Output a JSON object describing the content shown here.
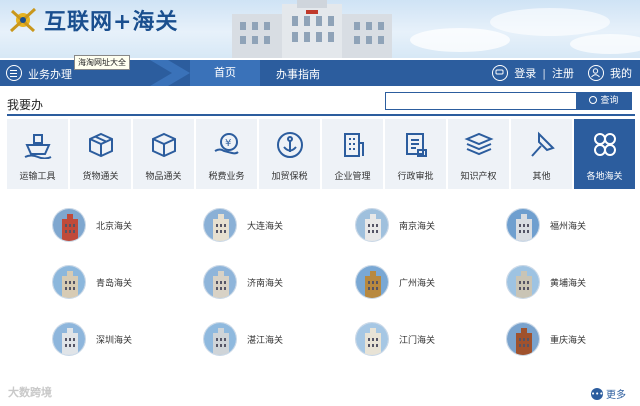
{
  "header": {
    "site_title": "互联网+海关",
    "tooltip": "海淘网址大全"
  },
  "navbar": {
    "business_label": "业务办理",
    "home_label": "首页",
    "guide_label": "办事指南",
    "login_label": "登录",
    "separator": "|",
    "register_label": "注册",
    "mine_label": "我的"
  },
  "section": {
    "title": "我要办",
    "search_placeholder": "",
    "search_button": "查询"
  },
  "categories": [
    {
      "label": "运输工具",
      "icon": "ship-icon"
    },
    {
      "label": "货物通关",
      "icon": "package-icon"
    },
    {
      "label": "物品通关",
      "icon": "box-icon"
    },
    {
      "label": "税费业务",
      "icon": "tax-icon"
    },
    {
      "label": "加贸保税",
      "icon": "anchor-icon"
    },
    {
      "label": "企业管理",
      "icon": "building-icon"
    },
    {
      "label": "行政审批",
      "icon": "document-icon"
    },
    {
      "label": "知识产权",
      "icon": "books-icon"
    },
    {
      "label": "其他",
      "icon": "pin-icon"
    },
    {
      "label": "各地海关",
      "icon": "clover-icon"
    }
  ],
  "cities": [
    {
      "name": "北京海关"
    },
    {
      "name": "大连海关"
    },
    {
      "name": "南京海关"
    },
    {
      "name": "福州海关"
    },
    {
      "name": "青岛海关"
    },
    {
      "name": "济南海关"
    },
    {
      "name": "广州海关"
    },
    {
      "name": "黄埔海关"
    },
    {
      "name": "深圳海关"
    },
    {
      "name": "湛江海关"
    },
    {
      "name": "江门海关"
    },
    {
      "name": "重庆海关"
    }
  ],
  "footer": {
    "watermark": "大数跨境",
    "more_label": "更多"
  },
  "colors": {
    "primary": "#2c5d9e",
    "active_tab": "#3a72b9",
    "tile_bg": "#eef2f7"
  }
}
